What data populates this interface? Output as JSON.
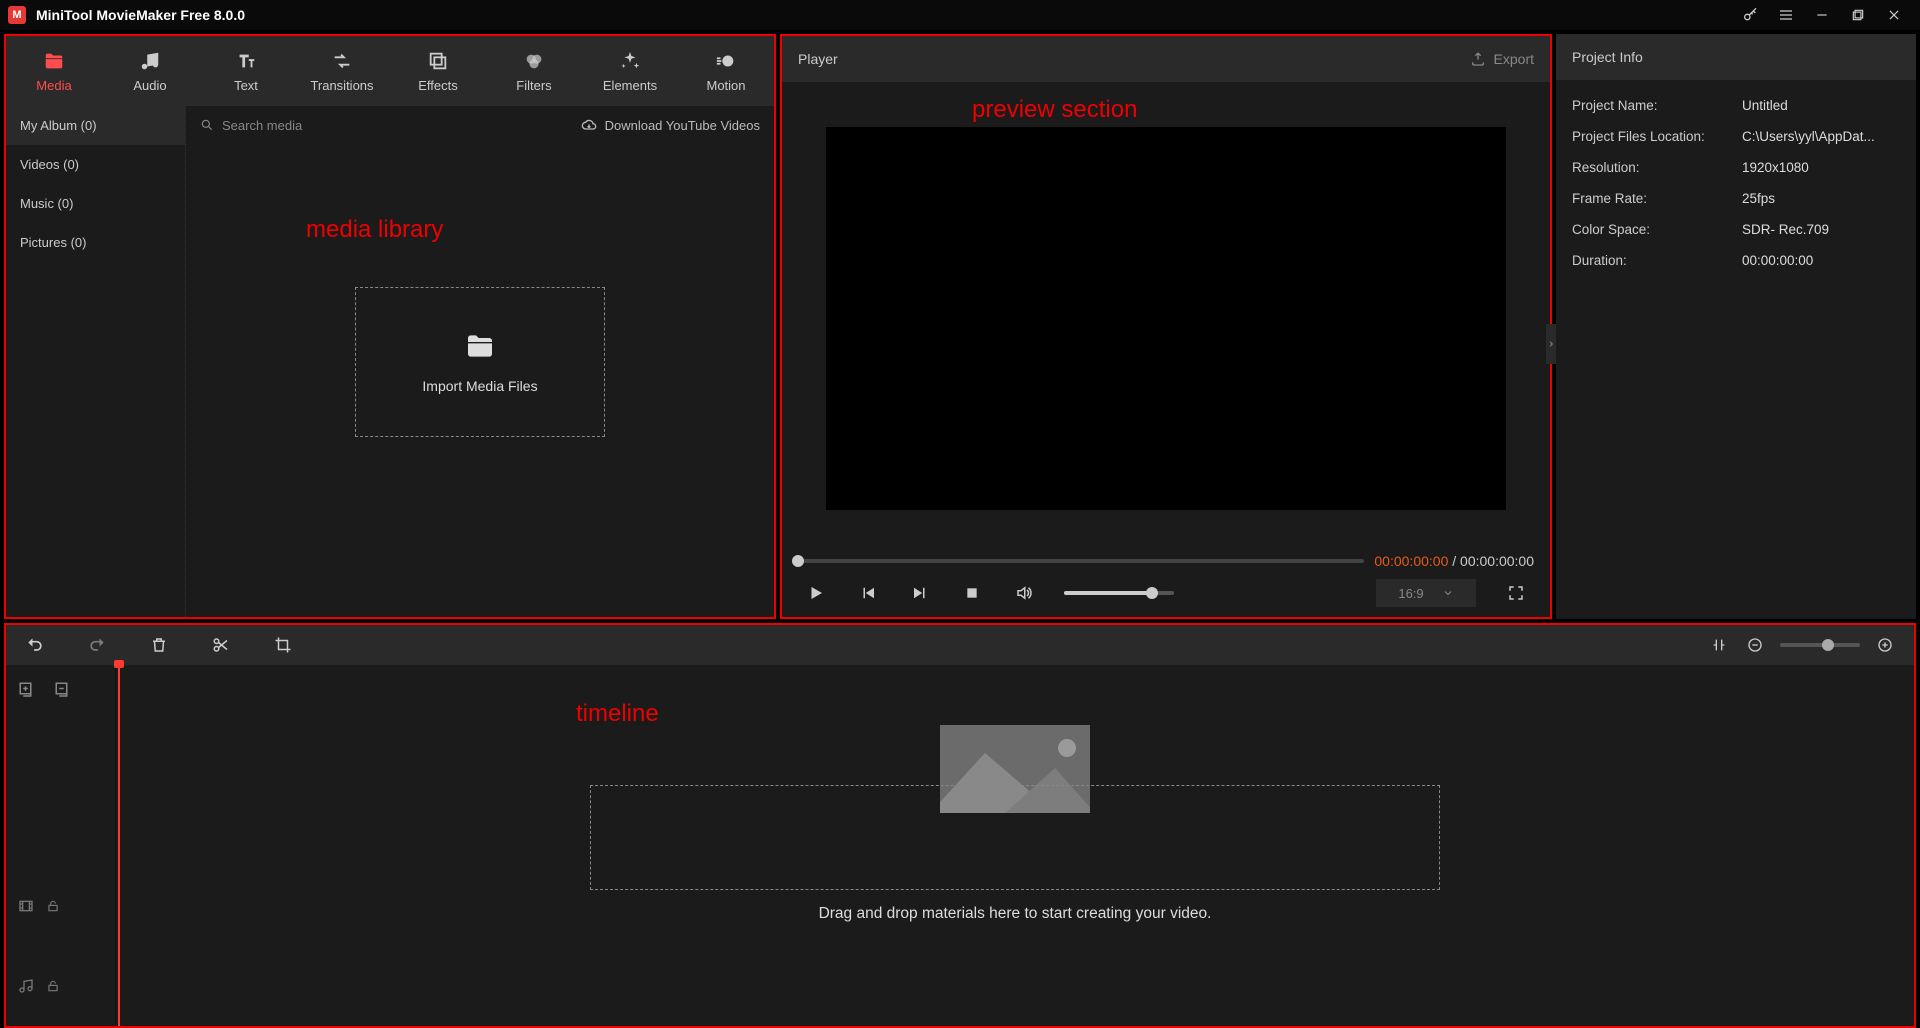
{
  "app": {
    "title": "MiniTool MovieMaker Free 8.0.0"
  },
  "topbar": {
    "tabs": [
      {
        "label": "Media"
      },
      {
        "label": "Audio"
      },
      {
        "label": "Text"
      },
      {
        "label": "Transitions"
      },
      {
        "label": "Effects"
      },
      {
        "label": "Filters"
      },
      {
        "label": "Elements"
      },
      {
        "label": "Motion"
      }
    ]
  },
  "albums": {
    "items": [
      {
        "label": "My Album (0)"
      },
      {
        "label": "Videos (0)"
      },
      {
        "label": "Music (0)"
      },
      {
        "label": "Pictures (0)"
      }
    ]
  },
  "media_toolbar": {
    "search_placeholder": "Search media",
    "download_label": "Download YouTube Videos"
  },
  "import_box": {
    "label": "Import Media Files"
  },
  "annotations": {
    "media_library": "media library",
    "preview_section": "preview section",
    "timeline": "timeline"
  },
  "player": {
    "title": "Player",
    "export_label": "Export",
    "timecode_current": "00:00:00:00",
    "timecode_separator": " / ",
    "timecode_total": "00:00:00:00",
    "aspect_ratio": "16:9"
  },
  "project_info": {
    "title": "Project Info",
    "rows": [
      {
        "k": "Project Name:",
        "v": "Untitled"
      },
      {
        "k": "Project Files Location:",
        "v": "C:\\Users\\yyl\\AppDat..."
      },
      {
        "k": "Resolution:",
        "v": "1920x1080"
      },
      {
        "k": "Frame Rate:",
        "v": "25fps"
      },
      {
        "k": "Color Space:",
        "v": "SDR- Rec.709"
      },
      {
        "k": "Duration:",
        "v": "00:00:00:00"
      }
    ]
  },
  "timeline": {
    "drop_message": "Drag and drop materials here to start creating your video."
  }
}
